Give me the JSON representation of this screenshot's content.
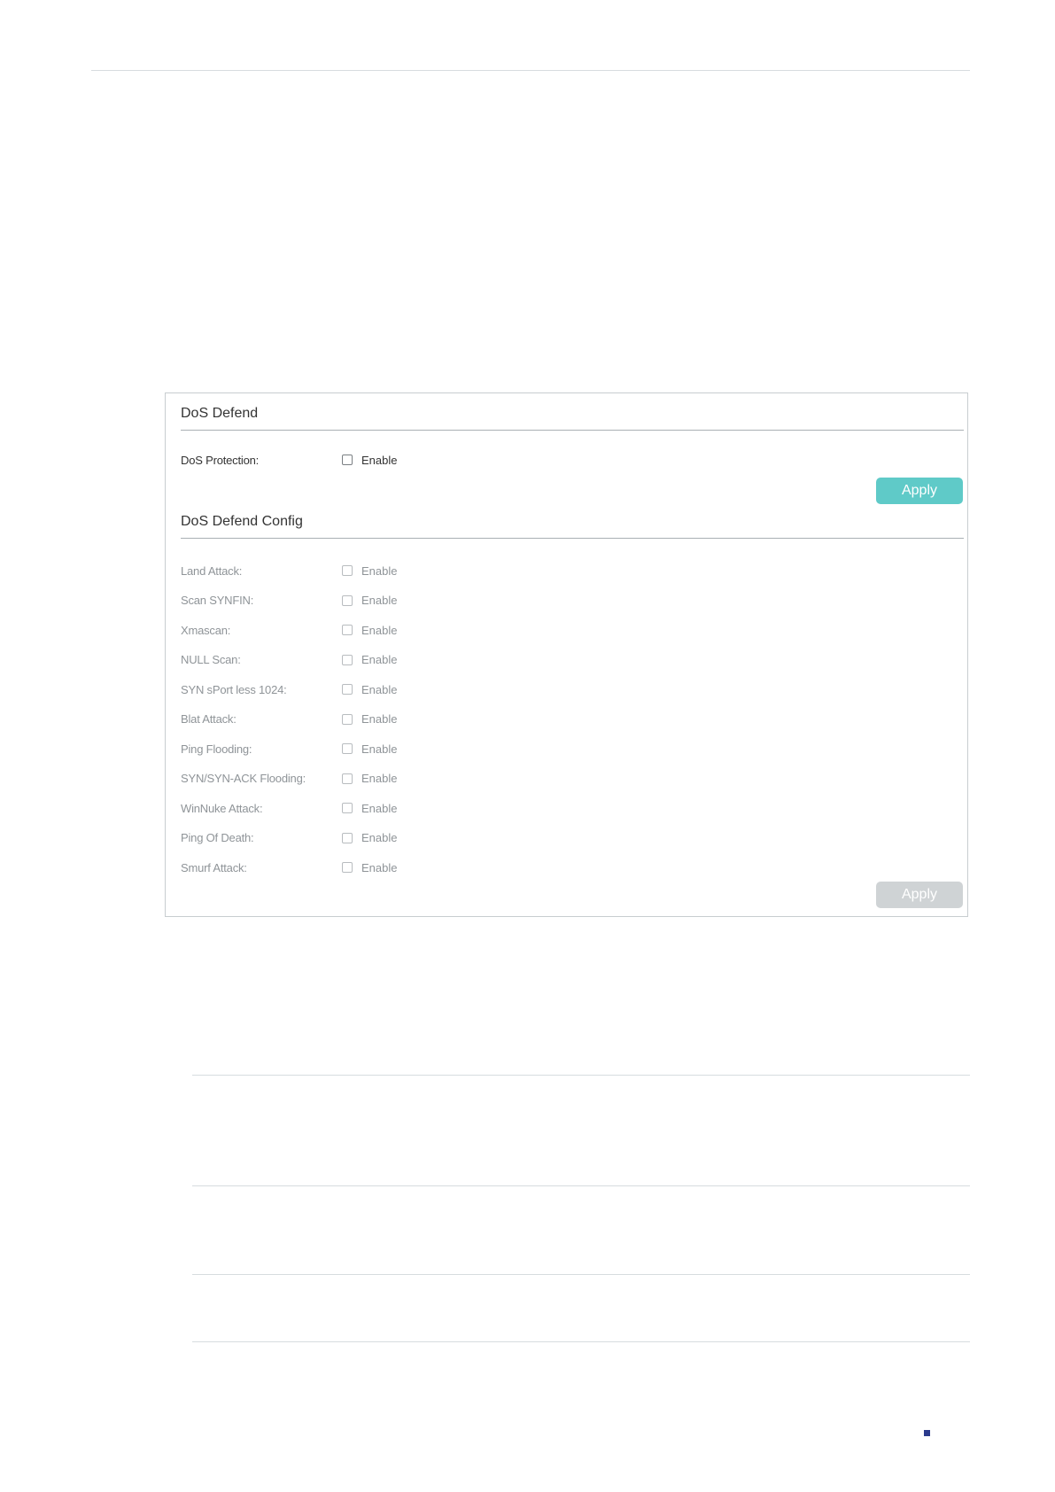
{
  "dos_defend": {
    "title": "DoS Defend",
    "protection": {
      "label": "DoS Protection:",
      "checkbox_label": "Enable",
      "checked": false
    },
    "apply_label": "Apply"
  },
  "dos_defend_config": {
    "title": "DoS Defend Config",
    "items": [
      {
        "label": "Land Attack:",
        "checkbox_label": "Enable"
      },
      {
        "label": "Scan SYNFIN:",
        "checkbox_label": "Enable"
      },
      {
        "label": "Xmascan:",
        "checkbox_label": "Enable"
      },
      {
        "label": "NULL Scan:",
        "checkbox_label": "Enable"
      },
      {
        "label": "SYN sPort less 1024:",
        "checkbox_label": "Enable"
      },
      {
        "label": "Blat Attack:",
        "checkbox_label": "Enable"
      },
      {
        "label": "Ping Flooding:",
        "checkbox_label": "Enable"
      },
      {
        "label": "SYN/SYN-ACK Flooding:",
        "checkbox_label": "Enable"
      },
      {
        "label": "WinNuke Attack:",
        "checkbox_label": "Enable"
      },
      {
        "label": "Ping Of Death:",
        "checkbox_label": "Enable"
      },
      {
        "label": "Smurf Attack:",
        "checkbox_label": "Enable"
      }
    ],
    "apply_label": "Apply",
    "disabled": true
  },
  "colors": {
    "accent": "#5fcac8",
    "disabled_button": "#cfd3d5",
    "page_marker": "#2b3a8c"
  }
}
